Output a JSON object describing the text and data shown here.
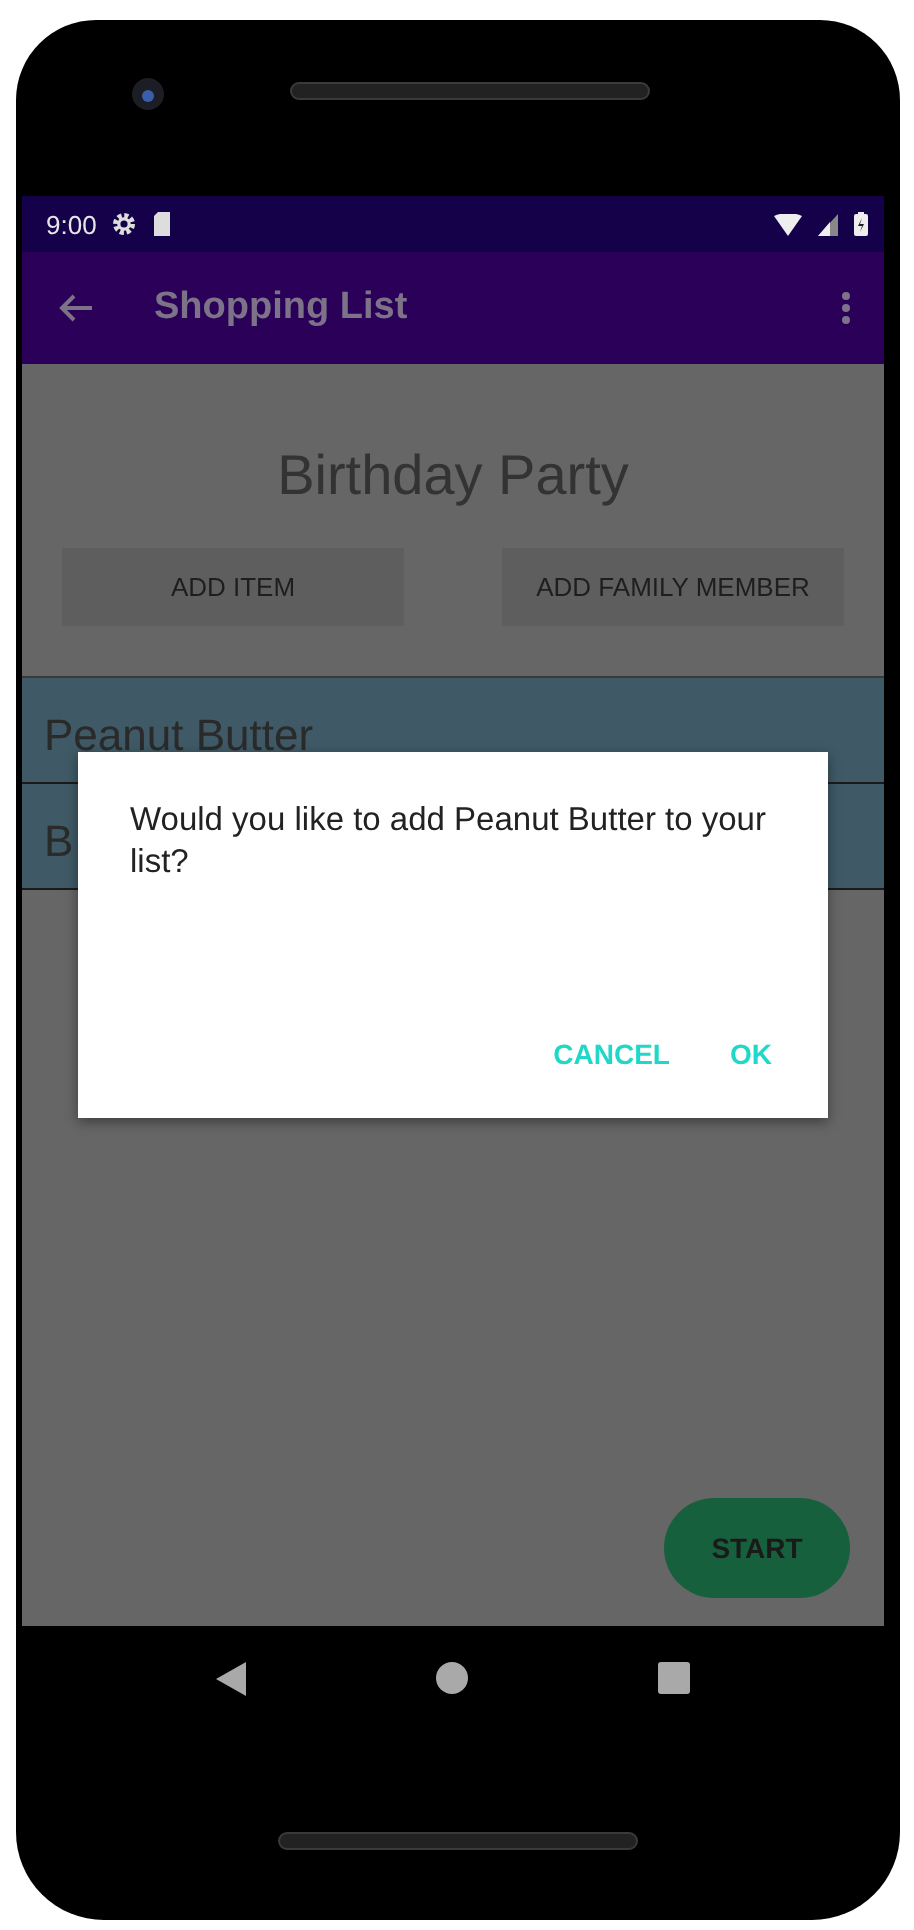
{
  "status_bar": {
    "time": "9:00"
  },
  "app_bar": {
    "title": "Shopping List"
  },
  "page": {
    "title": "Birthday Party",
    "buttons": [
      "ADD ITEM",
      "ADD FAMILY MEMBER"
    ],
    "items": [
      {
        "label": "Peanut Butter"
      },
      {
        "label": "B"
      }
    ],
    "fab": "START"
  },
  "dialog": {
    "message": "Would you like to add Peanut Butter to your list?",
    "buttons": [
      "CANCEL",
      "OK"
    ]
  }
}
